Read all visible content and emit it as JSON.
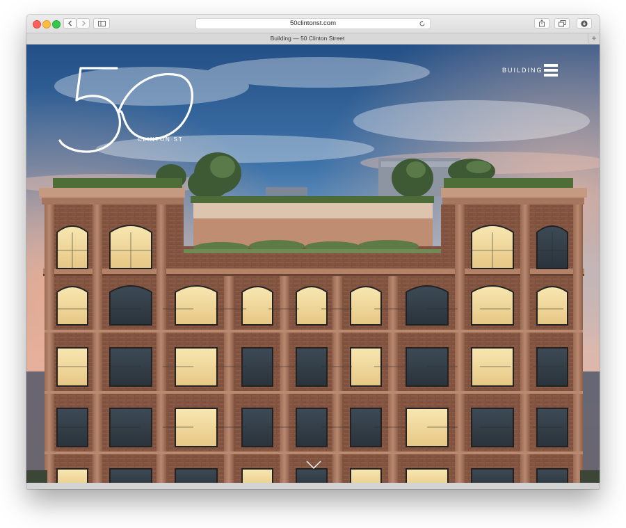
{
  "browser": {
    "url": "50clintonst.com",
    "tab_title": "Building — 50 Clinton Street",
    "toolbar_icons": [
      "back-icon",
      "forward-icon",
      "sidebar-icon",
      "reload-icon",
      "share-icon",
      "tabs-overview-icon",
      "downloads-icon",
      "new-tab-icon"
    ]
  },
  "site": {
    "logo_number": "50",
    "logo_subtitle": "CLINTON ST",
    "nav_label": "BUILDING",
    "menu_icon": "hamburger-menu-icon",
    "scroll_icon": "chevron-down-icon"
  },
  "hero": {
    "image": "Rendering of a red-brick loft building with arched windows and a landscaped rooftop at dusk"
  },
  "colors": {
    "sky_top": "#2f5f96",
    "sky_glow": "#e8b79c",
    "brick": "#7e5440",
    "window_glow": "#f2d99a"
  }
}
